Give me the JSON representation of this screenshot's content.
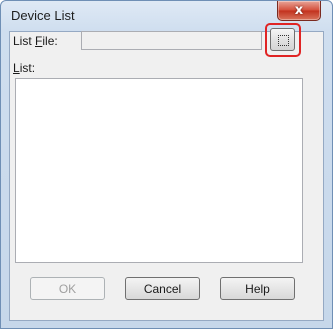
{
  "window": {
    "title": "Device List",
    "close_glyph": "x"
  },
  "list_file": {
    "label_prefix": "List ",
    "label_mnemonic": "F",
    "label_suffix": "ile:",
    "value": ""
  },
  "browse_button": {
    "icon": "ellipsis-box-icon",
    "highlight_color": "#e02424"
  },
  "list": {
    "label_mnemonic": "L",
    "label_suffix": "ist:",
    "items": []
  },
  "buttons": {
    "ok": "OK",
    "cancel": "Cancel",
    "help": "Help"
  }
}
